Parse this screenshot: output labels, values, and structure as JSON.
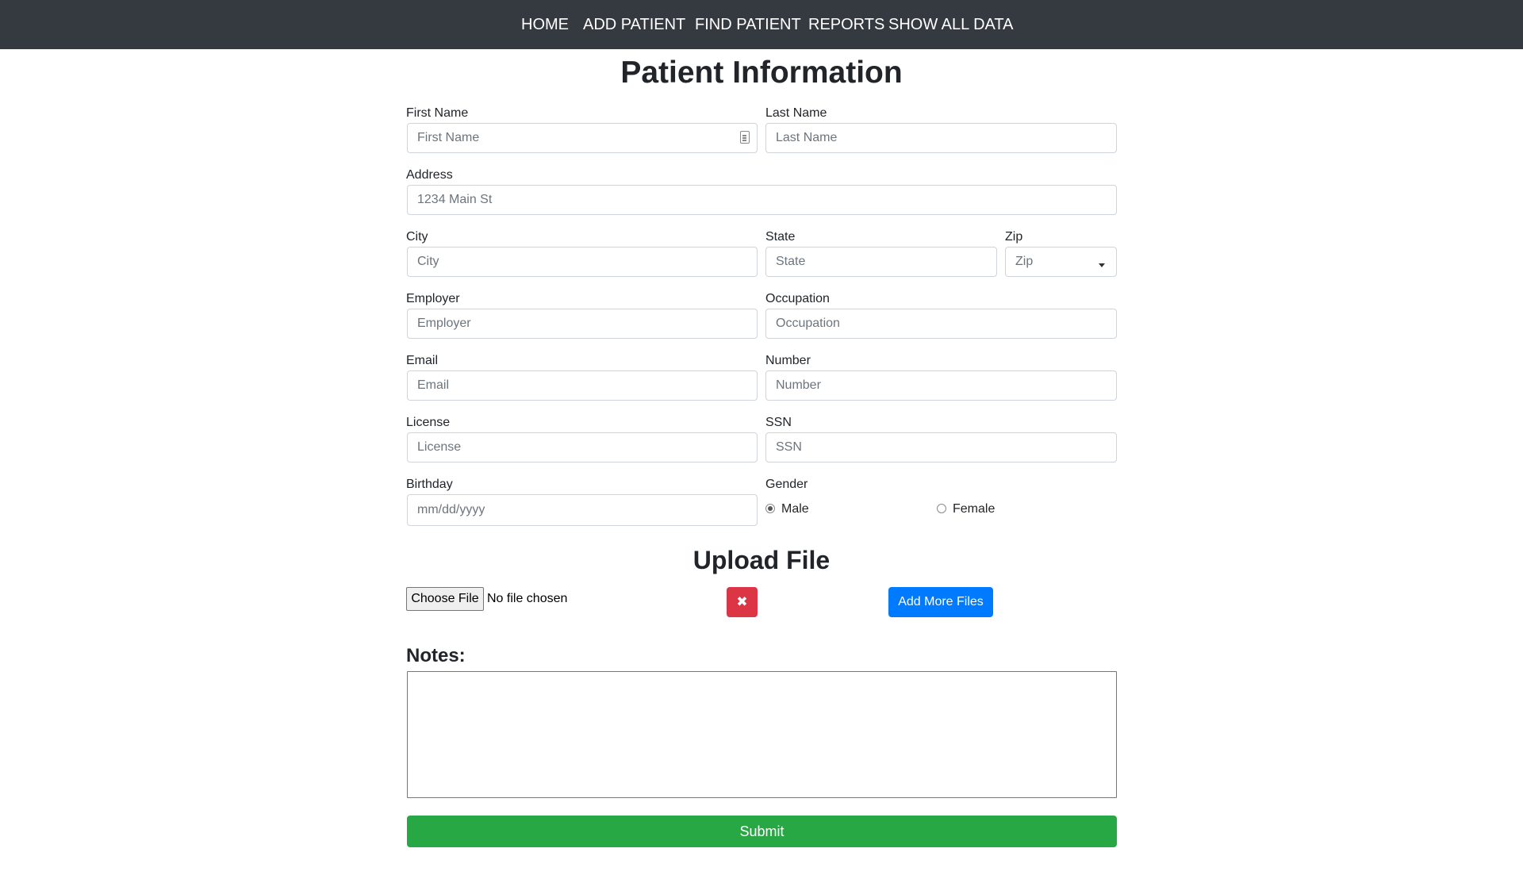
{
  "nav": {
    "items": [
      {
        "label": "HOME"
      },
      {
        "label": "ADD PATIENT"
      },
      {
        "label": "FIND PATIENT"
      },
      {
        "label": "REPORTS"
      },
      {
        "label": "SHOW ALL DATA"
      }
    ],
    "background_color": "#343a40"
  },
  "page_title": "Patient Information",
  "form": {
    "first_name": {
      "label": "First Name",
      "placeholder": "First Name"
    },
    "last_name": {
      "label": "Last Name",
      "placeholder": "Last Name"
    },
    "address": {
      "label": "Address",
      "placeholder": "1234 Main St"
    },
    "city": {
      "label": "City",
      "placeholder": "City"
    },
    "state": {
      "label": "State",
      "placeholder": "State"
    },
    "zip": {
      "label": "Zip",
      "selected": "Zip"
    },
    "employer": {
      "label": "Employer",
      "placeholder": "Employer"
    },
    "occupation": {
      "label": "Occupation",
      "placeholder": "Occupation"
    },
    "email": {
      "label": "Email",
      "placeholder": "Email"
    },
    "number": {
      "label": "Number",
      "placeholder": "Number"
    },
    "license": {
      "label": "License",
      "placeholder": "License"
    },
    "ssn": {
      "label": "SSN",
      "placeholder": "SSN"
    },
    "birthday": {
      "label": "Birthday",
      "placeholder": "mm/dd/yyyy"
    },
    "gender": {
      "label": "Gender",
      "options": [
        {
          "label": "Male",
          "checked": true
        },
        {
          "label": "Female",
          "checked": false
        }
      ]
    }
  },
  "upload": {
    "title": "Upload File",
    "choose_label": "Choose File",
    "status": "No file chosen",
    "remove_icon": "close-icon",
    "remove_symbol": "✖",
    "add_more_label": "Add More Files"
  },
  "notes": {
    "label": "Notes:",
    "value": ""
  },
  "submit_label": "Submit",
  "colors": {
    "danger": "#dc3545",
    "primary": "#007bff",
    "success": "#28a745"
  }
}
